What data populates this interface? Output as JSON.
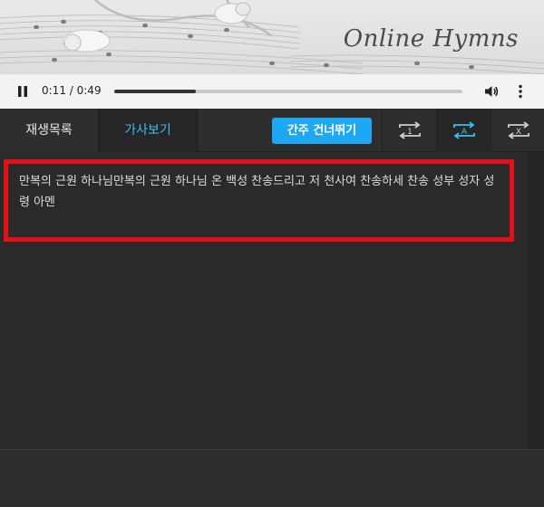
{
  "banner": {
    "title": "Online Hymns"
  },
  "player": {
    "current_time": "0:11",
    "duration": "0:49",
    "time_separator": " / ",
    "progress": 0.235
  },
  "tabs": [
    {
      "label": "재생목록",
      "active": false
    },
    {
      "label": "가사보기",
      "active": true
    }
  ],
  "toolbar": {
    "skip_intro_label": "간주 건너뛰기",
    "repeat_one_label": "1",
    "repeat_all_label": "A",
    "repeat_off_label": "X"
  },
  "lyrics": {
    "text": "만복의 근원 하나님만복의 근원 하나님 온 백성 찬송드리고 저 천사여 찬송하세 찬송 성부 성자 성령 아멘"
  },
  "colors": {
    "accent": "#35c2f0",
    "button": "#1ea7f2",
    "highlight": "#e3101a"
  }
}
